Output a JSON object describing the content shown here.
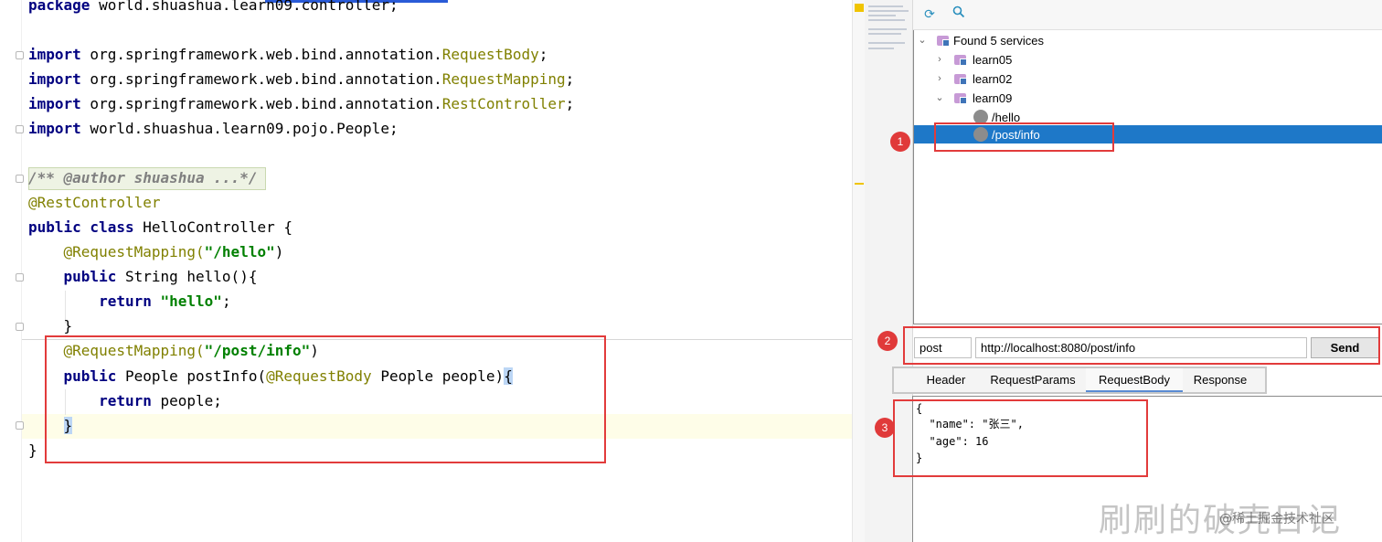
{
  "editor": {
    "lines": [
      {
        "parts": [
          {
            "c": "kw",
            "t": "package"
          },
          {
            "c": "plain",
            "t": " world.shuashua.learn09.controller;"
          }
        ]
      },
      {
        "parts": [
          {
            "c": "kw",
            "t": "import"
          },
          {
            "c": "plain",
            "t": " org.springframework.web.bind.annotation."
          },
          {
            "c": "ann",
            "t": "RequestBody"
          },
          {
            "c": "plain",
            "t": ";"
          }
        ]
      },
      {
        "parts": [
          {
            "c": "kw",
            "t": "import"
          },
          {
            "c": "plain",
            "t": " org.springframework.web.bind.annotation."
          },
          {
            "c": "ann",
            "t": "RequestMapping"
          },
          {
            "c": "plain",
            "t": ";"
          }
        ]
      },
      {
        "parts": [
          {
            "c": "kw",
            "t": "import"
          },
          {
            "c": "plain",
            "t": " org.springframework.web.bind.annotation."
          },
          {
            "c": "ann",
            "t": "RestController"
          },
          {
            "c": "plain",
            "t": ";"
          }
        ]
      },
      {
        "parts": [
          {
            "c": "kw",
            "t": "import"
          },
          {
            "c": "plain",
            "t": " world.shuashua.learn09.pojo.People;"
          }
        ]
      },
      {
        "parts": [
          {
            "c": "cm",
            "t": "/** @author shuashua ...*/"
          }
        ]
      },
      {
        "parts": [
          {
            "c": "ann",
            "t": "@RestController"
          }
        ]
      },
      {
        "parts": [
          {
            "c": "kw",
            "t": "public class"
          },
          {
            "c": "plain",
            "t": " HelloController {"
          }
        ]
      },
      {
        "parts": [
          {
            "c": "ann",
            "t": "    @RequestMapping("
          },
          {
            "c": "str",
            "t": "\"/hello\""
          },
          {
            "c": "plain",
            "t": ")"
          }
        ]
      },
      {
        "parts": [
          {
            "c": "kw",
            "t": "    public"
          },
          {
            "c": "plain",
            "t": " String hello(){"
          }
        ]
      },
      {
        "parts": [
          {
            "c": "kw",
            "t": "        return"
          },
          {
            "c": "plain",
            "t": " "
          },
          {
            "c": "str",
            "t": "\"hello\""
          },
          {
            "c": "plain",
            "t": ";"
          }
        ]
      },
      {
        "parts": [
          {
            "c": "plain",
            "t": "    }"
          }
        ]
      },
      {
        "parts": [
          {
            "c": "ann",
            "t": "    @RequestMapping("
          },
          {
            "c": "str",
            "t": "\"/post/info\""
          },
          {
            "c": "plain",
            "t": ")"
          }
        ]
      },
      {
        "parts": [
          {
            "c": "kw",
            "t": "    public"
          },
          {
            "c": "plain",
            "t": " People postInfo("
          },
          {
            "c": "ann",
            "t": "@RequestBody"
          },
          {
            "c": "plain",
            "t": " People people)"
          },
          {
            "c": "brace",
            "t": "{"
          }
        ]
      },
      {
        "parts": [
          {
            "c": "kw",
            "t": "        return"
          },
          {
            "c": "plain",
            "t": " people;"
          }
        ]
      },
      {
        "parts": [
          {
            "c": "plain",
            "t": "    "
          },
          {
            "c": "brace",
            "t": "}"
          }
        ]
      },
      {
        "parts": [
          {
            "c": "plain",
            "t": "}"
          }
        ]
      }
    ]
  },
  "panel": {
    "tree": {
      "root_label": "Found 5 services",
      "items": [
        {
          "label": "learn05",
          "expanded": false
        },
        {
          "label": "learn02",
          "expanded": false
        },
        {
          "label": "learn09",
          "expanded": true
        }
      ],
      "endpoints": [
        {
          "label": "/hello",
          "selected": false
        },
        {
          "label": "/post/info",
          "selected": true
        }
      ]
    },
    "request": {
      "method": "post",
      "url": "http://localhost:8080/post/info",
      "send_label": "Send"
    },
    "tabs": [
      {
        "label": "Header",
        "active": false
      },
      {
        "label": "RequestParams",
        "active": false
      },
      {
        "label": "RequestBody",
        "active": true
      },
      {
        "label": "Response",
        "active": false
      }
    ],
    "body_lines": [
      "{",
      "  \"name\": \"张三\",",
      "  \"age\": 16",
      "}"
    ]
  },
  "badges": [
    "1",
    "2",
    "3"
  ],
  "watermark": {
    "large": "刷刷的破壳日记",
    "small": "@稀土掘金技术社区"
  },
  "colors": {
    "keyword": "#000080",
    "annotation": "#808000",
    "string": "#008000",
    "highlight_box": "#e23b3b",
    "selection": "#1e78c8"
  }
}
